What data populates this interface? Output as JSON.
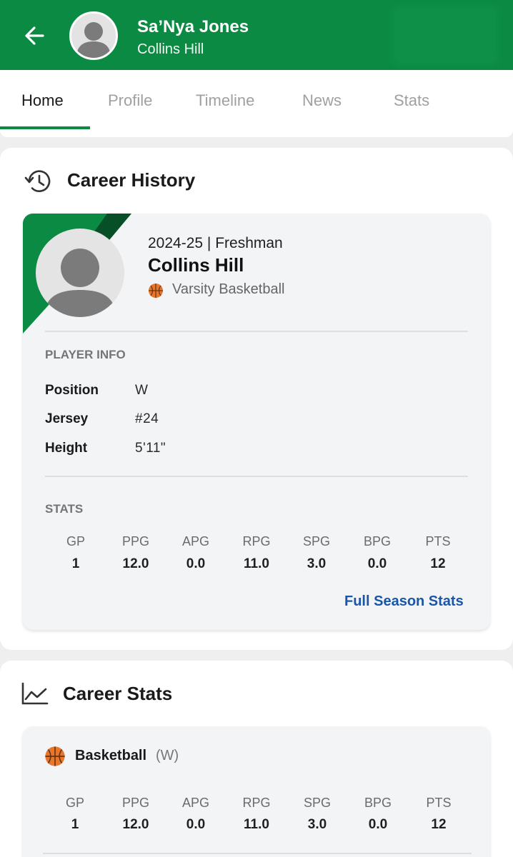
{
  "header": {
    "player_name": "Sa’Nya Jones",
    "school": "Collins Hill",
    "back_icon": "arrow-left-icon",
    "accent_color": "#0b8a43"
  },
  "tabs": [
    {
      "label": "Home",
      "active": true
    },
    {
      "label": "Profile",
      "active": false
    },
    {
      "label": "Timeline",
      "active": false
    },
    {
      "label": "News",
      "active": false
    },
    {
      "label": "Stats",
      "active": false
    }
  ],
  "career_history": {
    "title": "Career History",
    "icon": "history-icon",
    "season": "2024-25 | Freshman",
    "school": "Collins Hill",
    "team": "Varsity Basketball",
    "player_info_label": "PLAYER INFO",
    "info": [
      {
        "key": "Position",
        "value": "W"
      },
      {
        "key": "Jersey",
        "value": "#24"
      },
      {
        "key": "Height",
        "value": "5'11\""
      }
    ],
    "stats_label": "STATS",
    "stat_headers": [
      "GP",
      "PPG",
      "APG",
      "RPG",
      "SPG",
      "BPG",
      "PTS"
    ],
    "stat_values": [
      "1",
      "12.0",
      "0.0",
      "11.0",
      "3.0",
      "0.0",
      "12"
    ],
    "link_label": "Full Season Stats"
  },
  "career_stats": {
    "title": "Career Stats",
    "icon": "line-chart-icon",
    "sport": "Basketball",
    "position_tag": "(W)",
    "stat_headers": [
      "GP",
      "PPG",
      "APG",
      "RPG",
      "SPG",
      "BPG",
      "PTS"
    ],
    "stat_values": [
      "1",
      "12.0",
      "0.0",
      "11.0",
      "3.0",
      "0.0",
      "12"
    ]
  }
}
